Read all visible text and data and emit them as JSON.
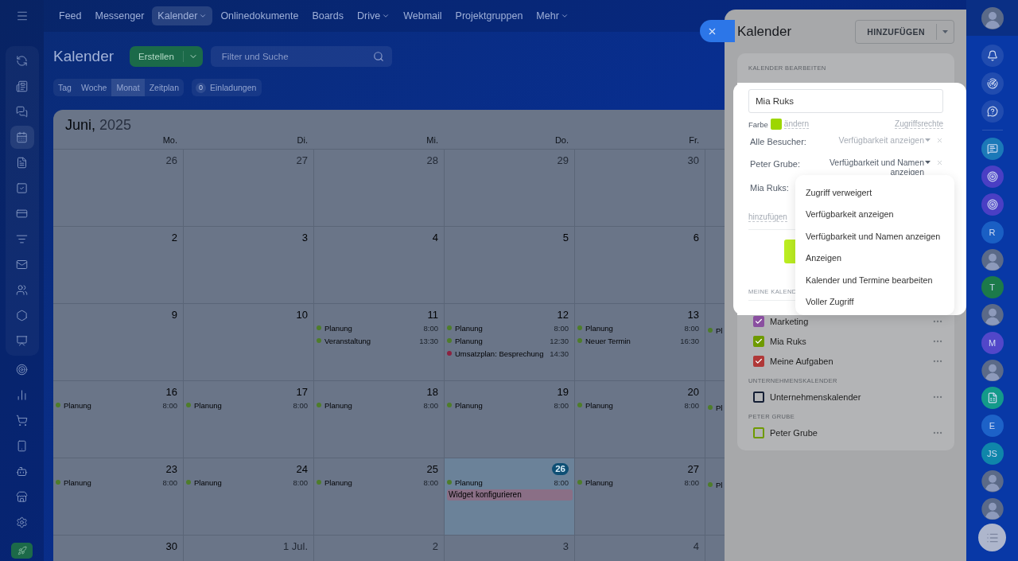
{
  "nav": {
    "items": [
      {
        "label": "Feed",
        "selected": false,
        "dropdown": false
      },
      {
        "label": "Messenger",
        "selected": false,
        "dropdown": false
      },
      {
        "label": "Kalender",
        "selected": true,
        "dropdown": true
      },
      {
        "label": "Onlinedokumente",
        "selected": false,
        "dropdown": false
      },
      {
        "label": "Boards",
        "selected": false,
        "dropdown": false
      },
      {
        "label": "Drive",
        "selected": false,
        "dropdown": true
      },
      {
        "label": "Webmail",
        "selected": false,
        "dropdown": false
      },
      {
        "label": "Projektgruppen",
        "selected": false,
        "dropdown": false
      },
      {
        "label": "Mehr",
        "selected": false,
        "dropdown": true
      }
    ]
  },
  "rail": {
    "items": [
      {
        "selected": false
      },
      {
        "selected": false
      },
      {
        "selected": false
      },
      {
        "selected": true
      },
      {
        "selected": false
      },
      {
        "selected": false
      },
      {
        "selected": false
      },
      {
        "selected": false
      },
      {
        "selected": false
      },
      {
        "selected": false
      },
      {
        "selected": false
      },
      {
        "selected": false
      },
      {
        "selected": false
      },
      {
        "selected": false
      },
      {
        "selected": false
      },
      {
        "selected": false
      },
      {
        "selected": false
      },
      {
        "selected": false
      },
      {
        "selected": false
      }
    ]
  },
  "header": {
    "title": "Kalender",
    "create_button": "Erstellen",
    "search": {
      "placeholder": "Filter und Suche"
    }
  },
  "views": [
    {
      "label": "Tag",
      "selected": false
    },
    {
      "label": "Woche",
      "selected": false
    },
    {
      "label": "Monat",
      "selected": true
    },
    {
      "label": "Zeitplan",
      "selected": false
    }
  ],
  "invitations": {
    "count": "0",
    "label": "Einladungen"
  },
  "calendar": {
    "month": "Juni,",
    "year": "2025",
    "weekdays": [
      "Mo.",
      "Di.",
      "Mi.",
      "Do.",
      "Fr."
    ],
    "weeks": [
      {
        "days": [
          {
            "date": "26",
            "muted": true,
            "today": false
          },
          {
            "date": "27",
            "muted": true,
            "today": false
          },
          {
            "date": "28",
            "muted": true,
            "today": false
          },
          {
            "date": "29",
            "muted": true,
            "today": false
          },
          {
            "date": "30",
            "muted": true,
            "today": false
          }
        ]
      },
      {
        "days": [
          {
            "date": "2",
            "muted": false,
            "today": false
          },
          {
            "date": "3",
            "muted": false,
            "today": false
          },
          {
            "date": "4",
            "muted": false,
            "today": false
          },
          {
            "date": "5",
            "muted": false,
            "today": false
          },
          {
            "date": "6",
            "muted": false,
            "today": false
          }
        ]
      },
      {
        "days": [
          {
            "date": "9",
            "muted": false,
            "today": false
          },
          {
            "date": "10",
            "muted": false,
            "today": false
          },
          {
            "date": "11",
            "muted": false,
            "today": false,
            "events": [
              {
                "kind": "dot",
                "title": "Planung",
                "time": "8:00",
                "color": "#4e7d2a"
              },
              {
                "kind": "dot",
                "title": "Veranstaltung",
                "time": "13:30",
                "color": "#4e7d2a"
              }
            ]
          },
          {
            "date": "12",
            "muted": false,
            "today": false,
            "events": [
              {
                "kind": "dot",
                "title": "Planung",
                "time": "8:00",
                "color": "#4e7d2a"
              },
              {
                "kind": "dot",
                "title": "Planung",
                "time": "12:30",
                "color": "#4e7d2a"
              },
              {
                "kind": "dot",
                "title": "Umsatzplan: Besprechung",
                "time": "14:30",
                "color": "#8c2240"
              }
            ]
          },
          {
            "date": "13",
            "muted": false,
            "today": false,
            "events": [
              {
                "kind": "dot",
                "title": "Planung",
                "time": "8:00",
                "color": "#4e7d2a"
              },
              {
                "kind": "dot",
                "title": "Neuer Termin",
                "time": "16:30",
                "color": "#4e7d2a"
              }
            ]
          }
        ],
        "clipped": [
          {
            "title": "Pl",
            "color": "#4e7d2a"
          }
        ]
      },
      {
        "days": [
          {
            "date": "16",
            "muted": false,
            "today": false,
            "events": [
              {
                "kind": "dot",
                "title": "Planung",
                "time": "8:00",
                "color": "#4e7d2a"
              }
            ]
          },
          {
            "date": "17",
            "muted": false,
            "today": false,
            "events": [
              {
                "kind": "dot",
                "title": "Planung",
                "time": "8:00",
                "color": "#4e7d2a"
              }
            ]
          },
          {
            "date": "18",
            "muted": false,
            "today": false,
            "events": [
              {
                "kind": "dot",
                "title": "Planung",
                "time": "8:00",
                "color": "#4e7d2a"
              }
            ]
          },
          {
            "date": "19",
            "muted": false,
            "today": false,
            "events": [
              {
                "kind": "dot",
                "title": "Planung",
                "time": "8:00",
                "color": "#4e7d2a"
              }
            ]
          },
          {
            "date": "20",
            "muted": false,
            "today": false,
            "events": [
              {
                "kind": "dot",
                "title": "Planung",
                "time": "8:00",
                "color": "#4e7d2a"
              }
            ]
          }
        ],
        "clipped": [
          {
            "title": "Pl",
            "color": "#4e7d2a"
          }
        ]
      },
      {
        "days": [
          {
            "date": "23",
            "muted": false,
            "today": false,
            "events": [
              {
                "kind": "dot",
                "title": "Planung",
                "time": "8:00",
                "color": "#4e7d2a"
              }
            ]
          },
          {
            "date": "24",
            "muted": false,
            "today": false,
            "events": [
              {
                "kind": "dot",
                "title": "Planung",
                "time": "8:00",
                "color": "#4e7d2a"
              }
            ]
          },
          {
            "date": "25",
            "muted": false,
            "today": false,
            "events": [
              {
                "kind": "dot",
                "title": "Planung",
                "time": "8:00",
                "color": "#4e7d2a"
              }
            ]
          },
          {
            "date": "26",
            "muted": false,
            "today": true,
            "events": [
              {
                "kind": "dot",
                "title": "Planung",
                "time": "8:00",
                "color": "#4e7d2a"
              },
              {
                "kind": "bar",
                "title": "Widget konfigurieren",
                "color": "#8a6f86"
              }
            ]
          },
          {
            "date": "27",
            "muted": false,
            "today": false,
            "events": [
              {
                "kind": "dot",
                "title": "Planung",
                "time": "8:00",
                "color": "#4e7d2a"
              }
            ]
          }
        ],
        "clipped": [
          {
            "title": "Pl",
            "color": "#4e7d2a"
          }
        ]
      },
      {
        "days": [
          {
            "date": "30",
            "muted": false,
            "today": false
          },
          {
            "date": "1 Jul.",
            "muted": true,
            "today": false
          },
          {
            "date": "2",
            "muted": true,
            "today": false
          },
          {
            "date": "3",
            "muted": true,
            "today": false
          },
          {
            "date": "4",
            "muted": true,
            "today": false
          }
        ]
      }
    ]
  },
  "panel": {
    "title": "Kalender",
    "add_button": "HINZUFÜGEN",
    "edit": {
      "heading": "KALENDER BEARBEITEN",
      "name": "Mia Ruks",
      "color_label": "Farbe",
      "color": "#9dd600",
      "change_link": "ändern",
      "rights_link": "Zugriffsrechte",
      "access": [
        {
          "name": "Alle Besucher:",
          "value": "Verfügbarkeit anzeigen",
          "selected": false
        },
        {
          "name": "Peter Grube:",
          "value": "Verfügbarkeit und Namen anzeigen",
          "selected": true
        },
        {
          "name": "Mia Ruks:"
        }
      ],
      "add_link": "hinzufügen"
    },
    "menu": {
      "items": [
        "Zugriff verweigert",
        "Verfügbarkeit anzeigen",
        "Verfügbarkeit und Namen anzeigen",
        "Anzeigen",
        "Kalender und Termine bearbeiten",
        "Voller Zugriff"
      ]
    },
    "calendars": {
      "heading": "MEINE KALEND",
      "sections": [
        {
          "items": [
            {
              "name": "Marketing",
              "color": "#8a4fa0",
              "checked": true
            },
            {
              "name": "Mia Ruks",
              "color": "#6e9a00",
              "checked": true
            },
            {
              "name": "Meine Aufgaben",
              "color": "#b03838",
              "checked": true
            }
          ]
        },
        {
          "heading": "UNTERNEHMENSKALENDER",
          "items": [
            {
              "name": "Unternehmenskalender",
              "color": "#141e34",
              "checked": false
            }
          ]
        },
        {
          "heading": "PETER GRUBE",
          "items": [
            {
              "name": "Peter Grube",
              "color": "#6e9a00",
              "checked": false
            }
          ]
        }
      ]
    }
  },
  "right_rail": {
    "items": [
      {
        "kind": "bell"
      },
      {
        "kind": "radar"
      },
      {
        "kind": "support"
      },
      {
        "kind": "divider"
      },
      {
        "kind": "messages",
        "color": "#1b79b8"
      },
      {
        "kind": "target",
        "color": "#4a3fc4"
      },
      {
        "kind": "target",
        "color": "#4a3fc4"
      },
      {
        "kind": "letter",
        "label": "R",
        "color": "#1a5fc4"
      },
      {
        "kind": "avatar"
      },
      {
        "kind": "letter",
        "label": "T",
        "color": "#1c7a4a"
      },
      {
        "kind": "avatar"
      },
      {
        "kind": "letter",
        "label": "M",
        "color": "#5247c9"
      },
      {
        "kind": "avatar"
      },
      {
        "kind": "document",
        "color": "#139a8a"
      },
      {
        "kind": "letter",
        "label": "E",
        "color": "#1d62c8"
      },
      {
        "kind": "letter",
        "label": "JS",
        "color": "#0f86aa"
      },
      {
        "kind": "avatar"
      },
      {
        "kind": "avatar"
      }
    ]
  }
}
